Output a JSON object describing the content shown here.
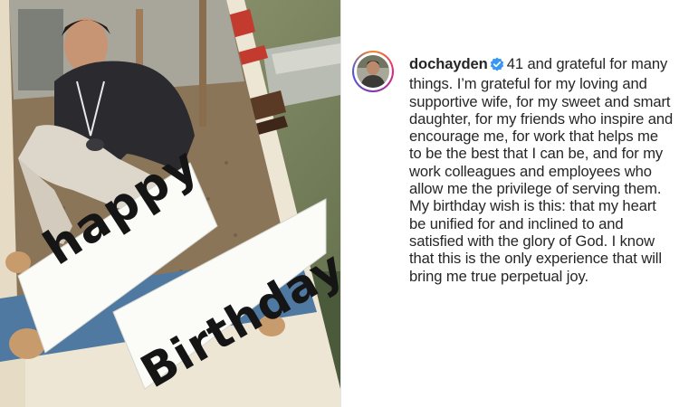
{
  "post": {
    "image": {
      "card_text_line1": "happy",
      "card_text_line2": "Birthday"
    },
    "caption": {
      "username": "dochayden",
      "paragraph1": "41 and grateful for many things. I’m grateful for my loving and supportive wife, for my sweet and smart daughter, for my friends who inspire and encourage me, for work that helps me to be the best that I can be, and for my work colleagues and employees who allow me the privilege of serving them.",
      "paragraph2": "My birthday wish is this: that my heart be unified for and inclined to and satisfied with the glory of God. I know that this is the only experience that will bring me true perpetual joy."
    }
  },
  "colors": {
    "verified_badge": "#3897f0",
    "text": "#262626",
    "card_blue": "#4f79a0",
    "card_cream": "#ece5d3"
  },
  "icons": {
    "verified": "verified-badge-icon",
    "avatar": "profile-avatar"
  }
}
